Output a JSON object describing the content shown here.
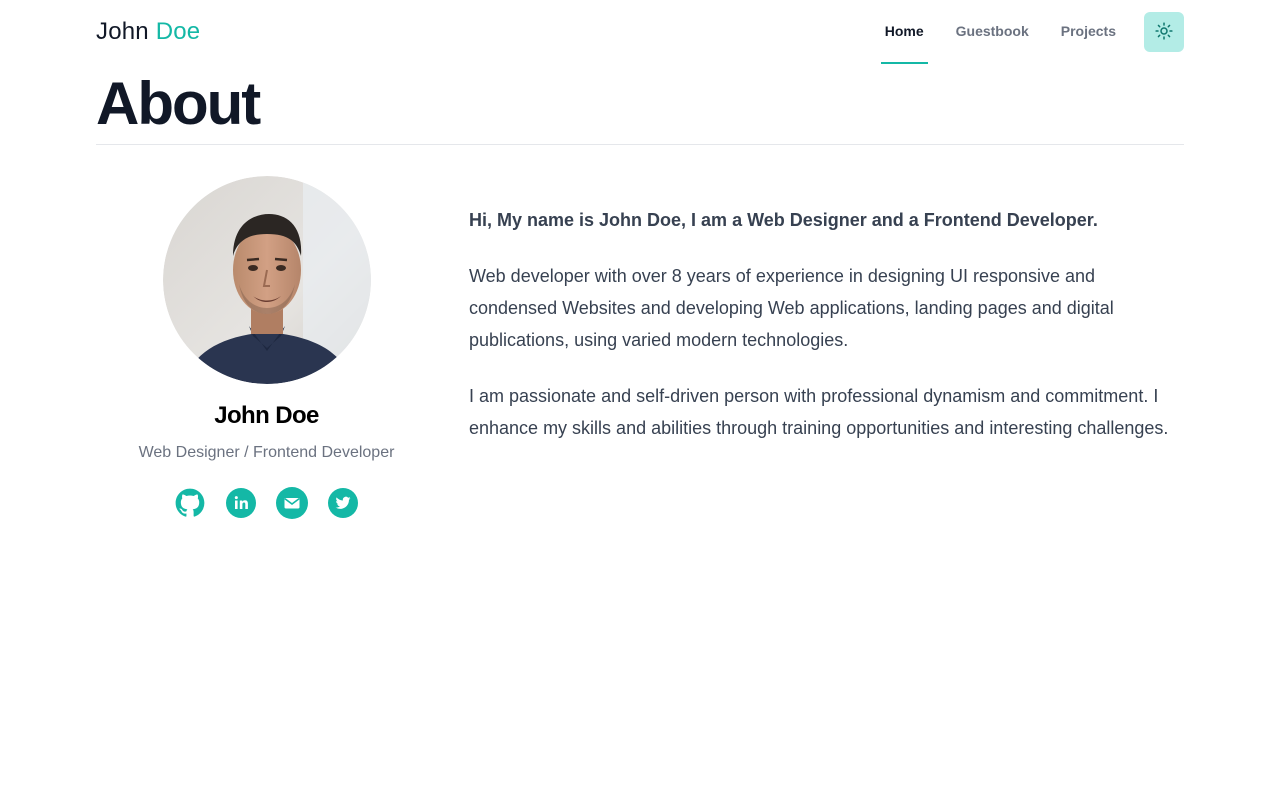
{
  "header": {
    "logo_first": "John",
    "logo_last": "Doe",
    "nav": [
      {
        "label": "Home",
        "active": true
      },
      {
        "label": "Guestbook",
        "active": false
      },
      {
        "label": "Projects",
        "active": false
      }
    ],
    "theme_toggle_icon": "sun-icon"
  },
  "page": {
    "title": "About"
  },
  "profile": {
    "name": "John Doe",
    "role": "Web Designer / Frontend Developer",
    "avatar_icon": "profile-photo",
    "socials": [
      {
        "icon": "github-icon"
      },
      {
        "icon": "linkedin-icon"
      },
      {
        "icon": "mail-icon"
      },
      {
        "icon": "twitter-icon"
      }
    ]
  },
  "bio": {
    "paragraphs": [
      "Hi, My name is John Doe, I am a Web Designer and a Frontend Developer.",
      "Web developer with over 8 years of experience in designing UI responsive and condensed Websites and developing Web applications, landing pages and digital publications, using varied modern technologies.",
      "I am passionate and self-driven person with professional dynamism and commitment. I enhance my skills and abilities through training opportunities and interesting challenges."
    ]
  },
  "colors": {
    "accent": "#14b8a6",
    "accent_light": "#b3ece6",
    "text": "#111827",
    "muted": "#6b7280"
  }
}
